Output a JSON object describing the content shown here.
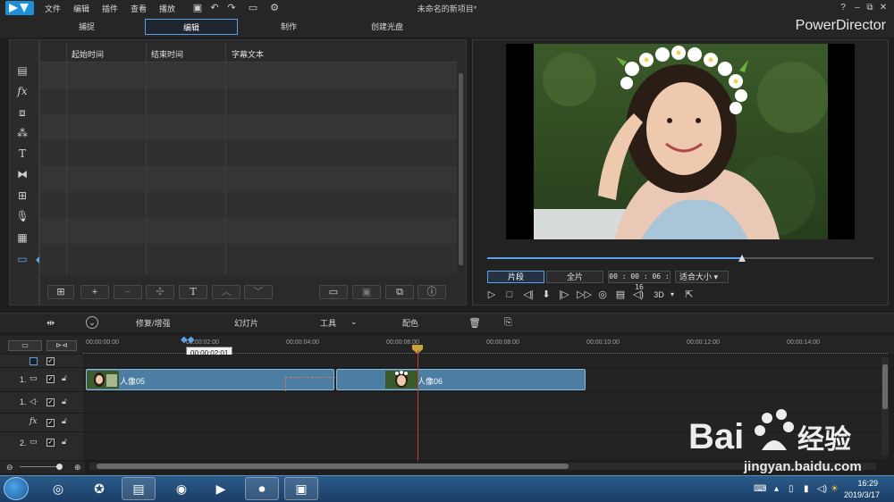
{
  "window": {
    "title": "未命名的新项目*",
    "brand": "PowerDirector",
    "menus": [
      "文件",
      "编辑",
      "插件",
      "查看",
      "播放"
    ]
  },
  "tabs": [
    {
      "label": "捕捉",
      "active": false
    },
    {
      "label": "编辑",
      "active": true
    },
    {
      "label": "制作",
      "active": false
    },
    {
      "label": "创建光盘",
      "active": false
    }
  ],
  "left_strip_icons": [
    "media-room-icon",
    "fx-icon",
    "pip-icon",
    "particle-icon",
    "title-icon",
    "transition-icon",
    "audio-mix-icon",
    "voice-over-icon",
    "chapter-icon",
    "subtitle-icon"
  ],
  "subtitle_panel": {
    "columns": [
      "起始时间",
      "结束时间",
      "字幕文本"
    ]
  },
  "preview": {
    "mode_clip": "片段",
    "mode_full": "全片",
    "timecode": "00 : 00 : 06 : 16",
    "fit": "适合大小",
    "three_d": "3D",
    "progress": 0.66
  },
  "timeline_toolbar": {
    "repair": "修复/增强",
    "slideshow": "幻灯片",
    "tools": "工具",
    "color": "配色"
  },
  "ruler": {
    "ticks": [
      "00:00:00:00",
      "00:00:02:00",
      "00:00:04:00",
      "00:00:06:00",
      "00:00:08:00",
      "00:00:10:00",
      "00:00:12:00",
      "00:00:14:00"
    ],
    "tooltip": "00:00:02:01"
  },
  "tracks": [
    {
      "label": "",
      "kind": "master"
    },
    {
      "label": "1.",
      "kind": "video"
    },
    {
      "label": "1.",
      "kind": "audio"
    },
    {
      "label": "fx",
      "kind": "fx"
    },
    {
      "label": "2.",
      "kind": "video"
    }
  ],
  "clips": [
    {
      "label": "人像05"
    },
    {
      "label": "人像06"
    }
  ],
  "taskbar": {
    "time": "16:29",
    "date": "2019/3/17"
  },
  "watermark": {
    "brand": "Bai 经验",
    "url": "jingyan.baidu.com"
  },
  "colors": {
    "accent": "#5aa3e8",
    "clip": "#4c7ea3",
    "playhead": "#c23a3a"
  }
}
